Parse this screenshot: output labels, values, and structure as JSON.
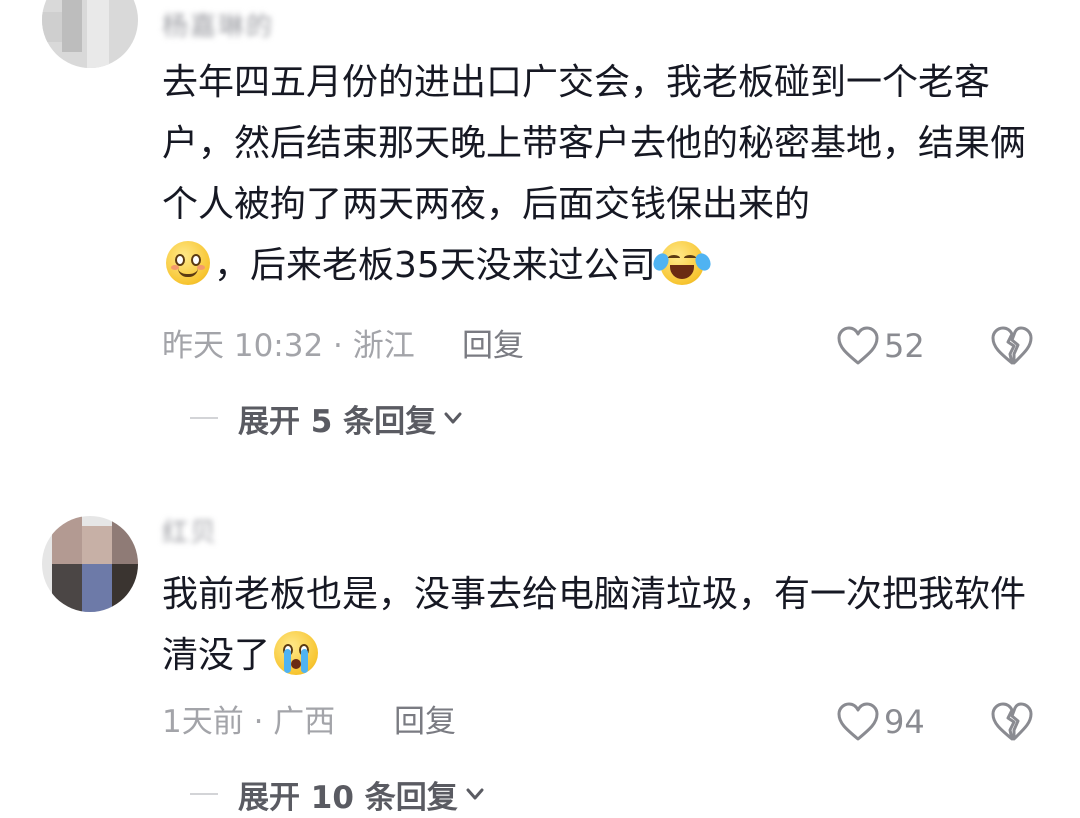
{
  "comments": [
    {
      "username": "杨嘉琳的",
      "text_part1": "去年四五月份的进出口广交会，我老板碰到一个老客户，然后结束那天晚上带客户去他的秘密基地，结果俩个人被拘了两天两夜，后面交钱保出来的",
      "text_part2": "，后来老板35天没来过公司",
      "emoji_inline_1": "smile-blush-emoji",
      "emoji_inline_2": "laugh-cry-emoji",
      "time": "昨天 10:32 · 浙江",
      "reply_label": "回复",
      "likes": "52",
      "expand_label": "展开 5 条回复"
    },
    {
      "username": "红贝",
      "text_part1": "我前老板也是，没事去给电脑清垃圾，有一次把我软件清没了",
      "emoji_inline_1": "crying-emoji",
      "time": "1天前 · 广西",
      "reply_label": "回复",
      "likes": "94",
      "expand_label": "展开 10 条回复"
    }
  ],
  "colors": {
    "text": "#161823",
    "meta": "#a3a4a9",
    "icon": "#8a8b91"
  }
}
